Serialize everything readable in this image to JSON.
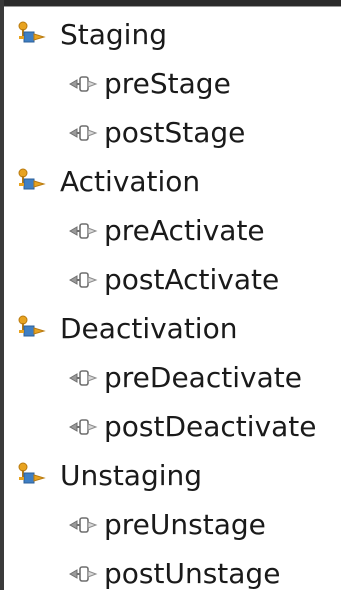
{
  "tree": {
    "groups": [
      {
        "label": "Staging",
        "icon": "lifecycle-group-icon",
        "items": [
          {
            "label": "preStage",
            "icon": "callback-method-icon"
          },
          {
            "label": "postStage",
            "icon": "callback-method-icon"
          }
        ]
      },
      {
        "label": "Activation",
        "icon": "lifecycle-group-icon",
        "items": [
          {
            "label": "preActivate",
            "icon": "callback-method-icon"
          },
          {
            "label": "postActivate",
            "icon": "callback-method-icon"
          }
        ]
      },
      {
        "label": "Deactivation",
        "icon": "lifecycle-group-icon",
        "items": [
          {
            "label": "preDeactivate",
            "icon": "callback-method-icon"
          },
          {
            "label": "postDeactivate",
            "icon": "callback-method-icon"
          }
        ]
      },
      {
        "label": "Unstaging",
        "icon": "lifecycle-group-icon",
        "items": [
          {
            "label": "preUnstage",
            "icon": "callback-method-icon"
          },
          {
            "label": "postUnstage",
            "icon": "callback-method-icon"
          }
        ]
      }
    ],
    "colors": {
      "group_icon_orange": "#e8a320",
      "group_icon_blue": "#3f7fc4",
      "member_icon_gray": "#8c8c8c",
      "text": "#1a1a1a"
    }
  }
}
